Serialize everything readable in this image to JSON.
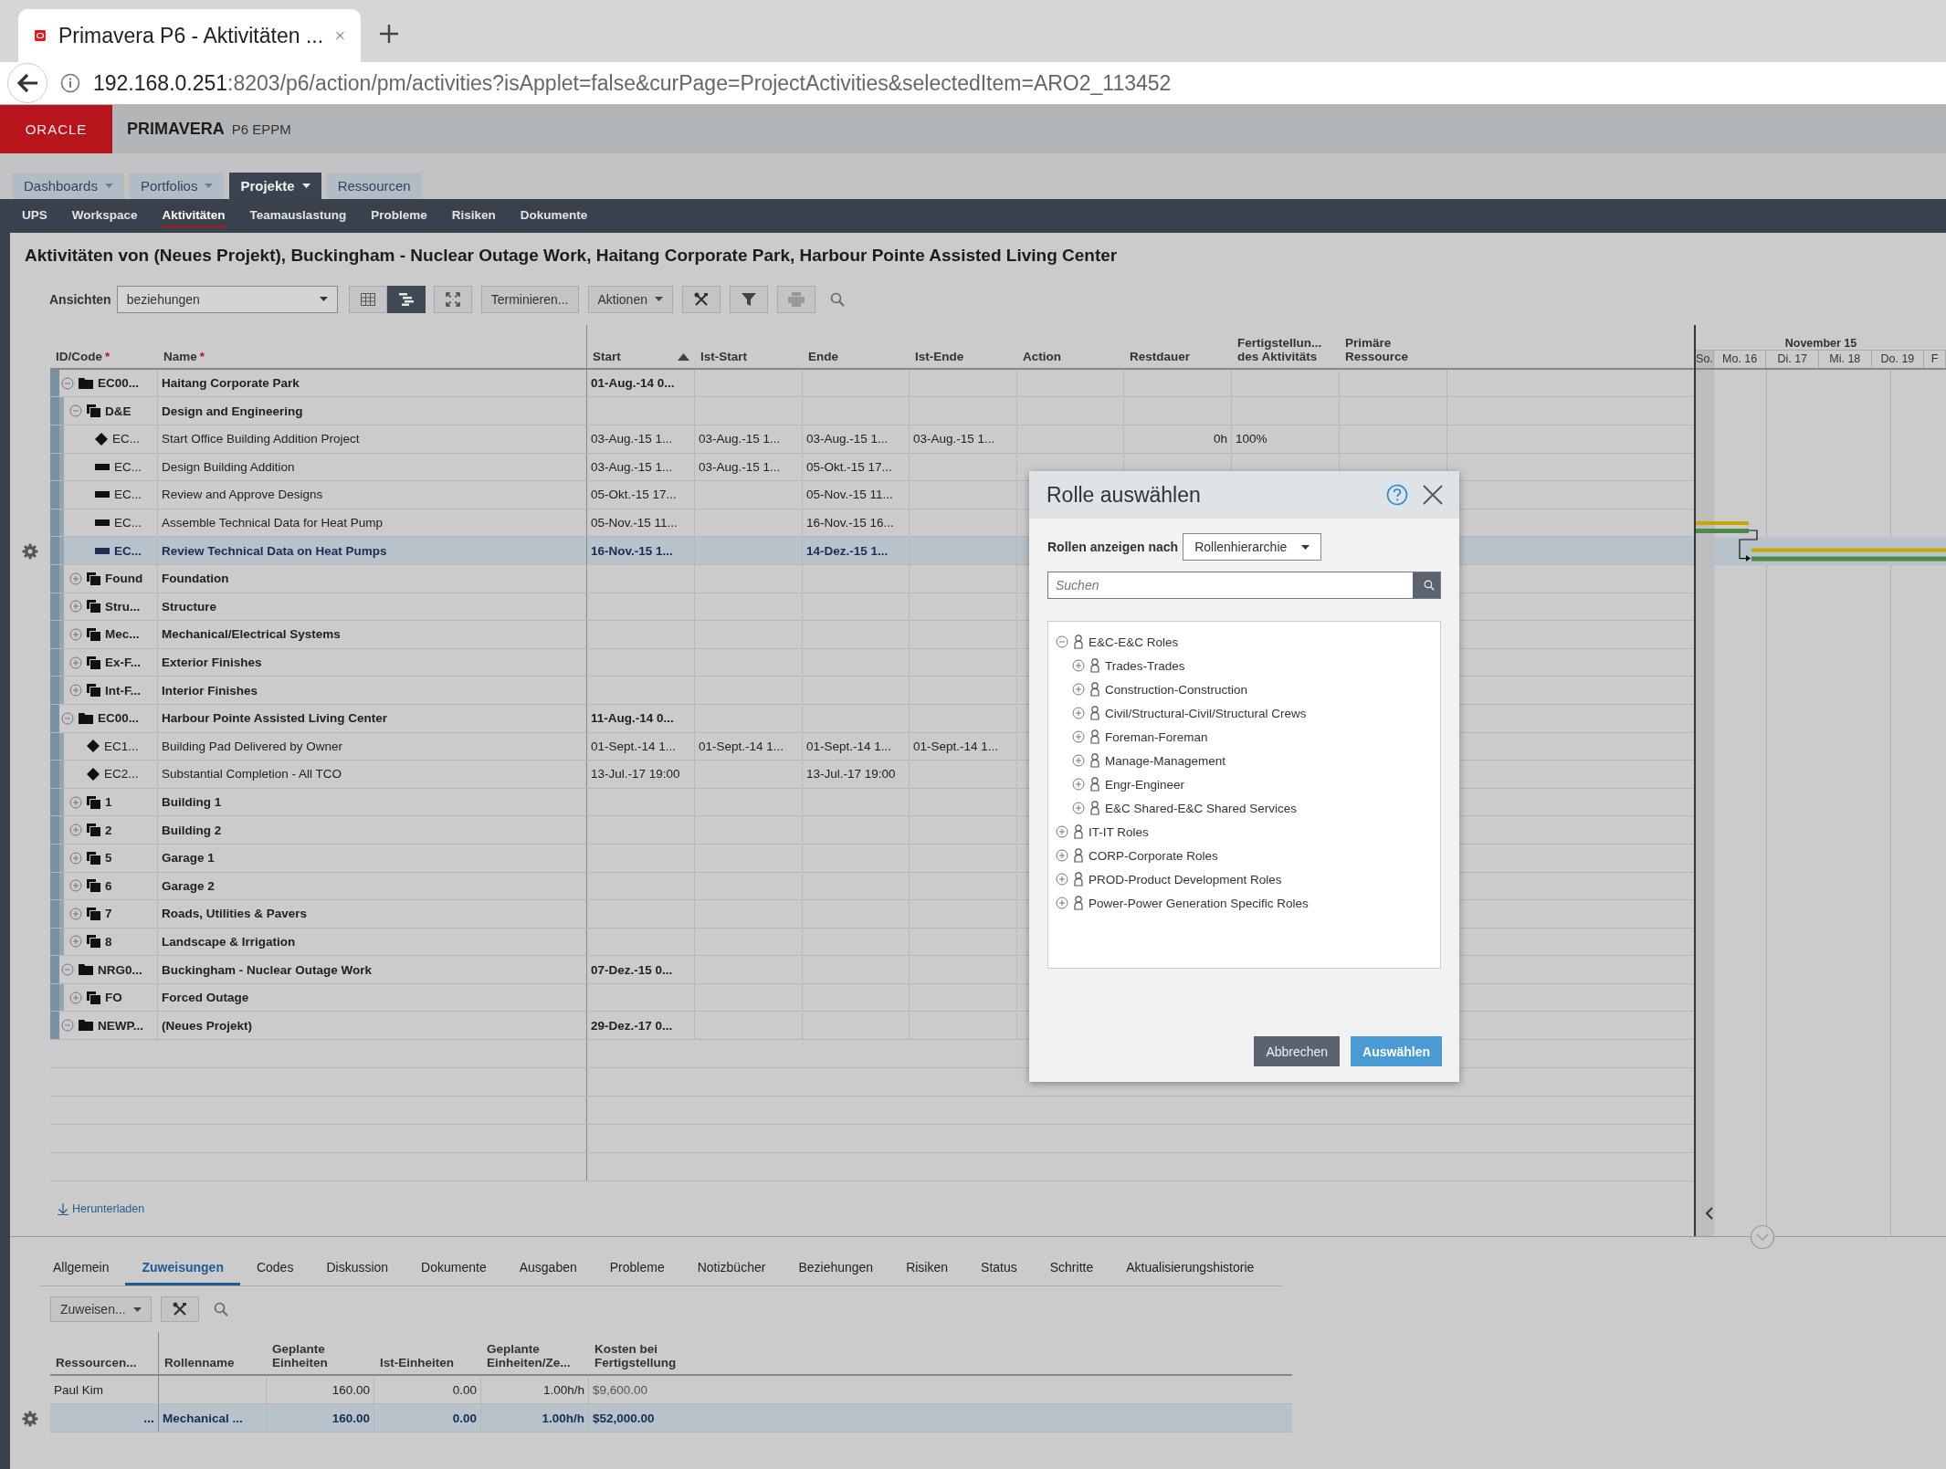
{
  "browser": {
    "tab_title": "Primavera P6 - Aktivitäten ...",
    "url_host": "192.168.0.251",
    "url_path": ":8203/p6/action/pm/activities?isApplet=false&curPage=ProjectActivities&selectedItem=ARO2_113452"
  },
  "app": {
    "brand": "ORACLE",
    "product": "PRIMAVERA",
    "edition": "P6 EPPM"
  },
  "top_tabs": [
    {
      "label": "Dashboards",
      "dropdown": true,
      "selected": false
    },
    {
      "label": "Portfolios",
      "dropdown": true,
      "selected": false
    },
    {
      "label": "Projekte",
      "dropdown": true,
      "selected": true
    },
    {
      "label": "Ressourcen",
      "dropdown": false,
      "selected": false
    }
  ],
  "sub_nav": [
    {
      "label": "UPS",
      "selected": false
    },
    {
      "label": "Workspace",
      "selected": false
    },
    {
      "label": "Aktivitäten",
      "selected": true
    },
    {
      "label": "Teamauslastung",
      "selected": false
    },
    {
      "label": "Probleme",
      "selected": false
    },
    {
      "label": "Risiken",
      "selected": false
    },
    {
      "label": "Dokumente",
      "selected": false
    }
  ],
  "page_title": "Aktivitäten von (Neues Projekt), Buckingham - Nuclear Outage Work, Haitang Corporate Park, Harbour Pointe Assisted Living Center",
  "toolbar": {
    "views_label": "Ansichten",
    "view": "beziehungen",
    "layout_buttons": [
      {
        "kind": "table",
        "selected": false
      },
      {
        "kind": "gantt",
        "selected": true
      }
    ],
    "schedule_button": "Terminieren...",
    "actions_button": "Aktionen",
    "print_disabled": true
  },
  "activities": {
    "columns": [
      {
        "lines": [
          "ID/Code"
        ],
        "mark": "*"
      },
      {
        "lines": [
          "Name"
        ],
        "mark": "*"
      },
      {
        "lines": [
          "Start"
        ],
        "sort_ascending": true
      },
      {
        "lines": [
          "Ist-Start"
        ]
      },
      {
        "lines": [
          "Ende"
        ]
      },
      {
        "lines": [
          "Ist-Ende"
        ]
      },
      {
        "lines": [
          "Action"
        ]
      },
      {
        "lines": [
          "Restdauer"
        ]
      },
      {
        "lines": [
          "Fertigstellun...",
          "des Aktivitäts"
        ]
      },
      {
        "lines": [
          "Primäre",
          "Ressource"
        ]
      }
    ],
    "rows": [
      {
        "kind": "project",
        "id": "EC00...",
        "name": "Haitang Corporate Park",
        "expanded": true,
        "selected": false,
        "start": "01-Aug.-14 0...",
        "children": [
          {
            "kind": "wbs",
            "id": "D&E",
            "name": "Design and Engineering",
            "expanded": true,
            "selected": false,
            "children": [
              {
                "kind": "milestone",
                "id": "EC...",
                "name": "Start Office Building Addition Project",
                "selected": false,
                "start": "03-Aug.-15 1...",
                "ist_start": "03-Aug.-15 1...",
                "ende": "03-Aug.-15 1...",
                "ist_ende": "03-Aug.-15 1...",
                "restdauer": "0h",
                "fertigstellung": "100%"
              },
              {
                "kind": "task",
                "id": "EC...",
                "name": "Design Building Addition",
                "selected": false,
                "start": "03-Aug.-15 1...",
                "ist_start": "03-Aug.-15 1...",
                "ende": "05-Okt.-15 17..."
              },
              {
                "kind": "task",
                "id": "EC...",
                "name": "Review and Approve Designs",
                "selected": false,
                "start": "05-Okt.-15 17...",
                "ende": "05-Nov.-15 11..."
              },
              {
                "kind": "task",
                "id": "EC...",
                "name": "Assemble Technical Data for Heat Pump",
                "selected": false,
                "start": "05-Nov.-15 11...",
                "ende": "16-Nov.-15 16..."
              },
              {
                "kind": "task",
                "id": "EC...",
                "name": "Review Technical Data on Heat Pumps",
                "selected": true,
                "start": "16-Nov.-15 1...",
                "ende": "14-Dez.-15 1..."
              }
            ]
          },
          {
            "kind": "wbs",
            "id": "Found",
            "name": "Foundation",
            "expanded": false,
            "selected": false
          },
          {
            "kind": "wbs",
            "id": "Stru...",
            "name": "Structure",
            "expanded": false,
            "selected": false
          },
          {
            "kind": "wbs",
            "id": "Mec...",
            "name": "Mechanical/Electrical Systems",
            "expanded": false,
            "selected": false
          },
          {
            "kind": "wbs",
            "id": "Ex-F...",
            "name": "Exterior Finishes",
            "expanded": false,
            "selected": false
          },
          {
            "kind": "wbs",
            "id": "Int-F...",
            "name": "Interior Finishes",
            "expanded": false,
            "selected": false
          }
        ]
      },
      {
        "kind": "project",
        "id": "EC00...",
        "name": "Harbour Pointe Assisted Living Center",
        "expanded": true,
        "selected": false,
        "start": "11-Aug.-14 0...",
        "children": [
          {
            "kind": "milestone",
            "id": "EC1...",
            "name": "Building Pad Delivered by Owner",
            "selected": false,
            "start": "01-Sept.-14 1...",
            "ist_start": "01-Sept.-14 1...",
            "ende": "01-Sept.-14 1...",
            "ist_ende": "01-Sept.-14 1..."
          },
          {
            "kind": "milestone",
            "id": "EC2...",
            "name": "Substantial Completion - All TCO",
            "selected": false,
            "start": "13-Jul.-17 19:00",
            "ende": "13-Jul.-17 19:00"
          },
          {
            "kind": "wbs",
            "id": "1",
            "name": "Building 1",
            "expanded": false,
            "selected": false
          },
          {
            "kind": "wbs",
            "id": "2",
            "name": "Building 2",
            "expanded": false,
            "selected": false
          },
          {
            "kind": "wbs",
            "id": "5",
            "name": "Garage 1",
            "expanded": false,
            "selected": false
          },
          {
            "kind": "wbs",
            "id": "6",
            "name": "Garage 2",
            "expanded": false,
            "selected": false
          },
          {
            "kind": "wbs",
            "id": "7",
            "name": "Roads, Utilities & Pavers",
            "expanded": false,
            "selected": false
          },
          {
            "kind": "wbs",
            "id": "8",
            "name": "Landscape & Irrigation",
            "expanded": false,
            "selected": false
          }
        ]
      },
      {
        "kind": "project",
        "id": "NRG0...",
        "name": "Buckingham - Nuclear Outage Work",
        "expanded": true,
        "selected": false,
        "start": "07-Dez.-15 0...",
        "children": [
          {
            "kind": "wbs",
            "id": "FO",
            "name": "Forced Outage",
            "expanded": false,
            "selected": false
          }
        ]
      },
      {
        "kind": "project",
        "id": "NEWP...",
        "name": "(Neues Projekt)",
        "expanded": true,
        "selected": false,
        "start": "29-Dez.-17 0..."
      }
    ]
  },
  "gantt": {
    "month": "November 15",
    "days": [
      "So.",
      "Mo. 16",
      "Di. 17",
      "Mi. 18",
      "Do. 19",
      "F"
    ]
  },
  "download_link": "Herunterladen",
  "detail_tabs": [
    {
      "label": "Allgemein",
      "selected": false
    },
    {
      "label": "Zuweisungen",
      "selected": true
    },
    {
      "label": "Codes",
      "selected": false
    },
    {
      "label": "Diskussion",
      "selected": false
    },
    {
      "label": "Dokumente",
      "selected": false
    },
    {
      "label": "Ausgaben",
      "selected": false
    },
    {
      "label": "Probleme",
      "selected": false
    },
    {
      "label": "Notizbücher",
      "selected": false
    },
    {
      "label": "Beziehungen",
      "selected": false
    },
    {
      "label": "Risiken",
      "selected": false
    },
    {
      "label": "Status",
      "selected": false
    },
    {
      "label": "Schritte",
      "selected": false
    },
    {
      "label": "Aktualisierungshistorie",
      "selected": false
    }
  ],
  "assignments": {
    "assign_button": "Zuweisen...",
    "columns": [
      {
        "lines": [
          "Ressourcen..."
        ]
      },
      {
        "lines": [
          "Rollenname"
        ]
      },
      {
        "lines": [
          "Geplante",
          "Einheiten"
        ]
      },
      {
        "lines": [
          "Ist-Einheiten"
        ]
      },
      {
        "lines": [
          "Geplante",
          "Einheiten/Ze..."
        ]
      },
      {
        "lines": [
          "Kosten bei",
          "Fertigstellung"
        ]
      }
    ],
    "rows": [
      {
        "selected": false,
        "resource": "Paul Kim",
        "planned": "160.00",
        "actual": "0.00",
        "rate": "1.00h/h",
        "cost": "$9,600.00"
      },
      {
        "selected": true,
        "more": "...",
        "role": "Mechanical ...",
        "planned": "160.00",
        "actual": "0.00",
        "rate": "1.00h/h",
        "cost": "$52,000.00"
      }
    ]
  },
  "dialog": {
    "title": "Rolle auswählen",
    "filter_label": "Rollen anzeigen nach",
    "filter_value": "Rollenhierarchie",
    "search_placeholder": "Suchen",
    "roles": [
      {
        "label": "E&C-E&C Roles",
        "expanded": true,
        "children": [
          {
            "label": "Trades-Trades",
            "expanded": false
          },
          {
            "label": "Construction-Construction",
            "expanded": false
          },
          {
            "label": "Civil/Structural-Civil/Structural Crews",
            "expanded": false
          },
          {
            "label": "Foreman-Foreman",
            "expanded": false
          },
          {
            "label": "Manage-Management",
            "expanded": false
          },
          {
            "label": "Engr-Engineer",
            "expanded": false
          },
          {
            "label": "E&C Shared-E&C Shared Services",
            "expanded": false
          }
        ]
      },
      {
        "label": "IT-IT Roles",
        "expanded": false
      },
      {
        "label": "CORP-Corporate Roles",
        "expanded": false
      },
      {
        "label": "PROD-Product Development Roles",
        "expanded": false
      },
      {
        "label": "Power-Power Generation Specific Roles",
        "expanded": false
      }
    ],
    "buttons": [
      {
        "label": "Abbrechen",
        "kind": "secondary"
      },
      {
        "label": "Auswählen",
        "kind": "primary"
      }
    ]
  }
}
